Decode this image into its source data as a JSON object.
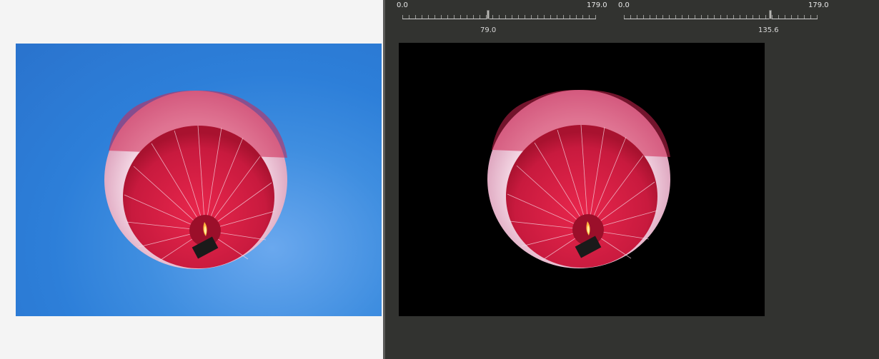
{
  "sliders": [
    {
      "min_label": "0.0",
      "max_label": "179.0",
      "min": 0,
      "max": 179,
      "value": 79.0,
      "value_label": "79.0"
    },
    {
      "min_label": "0.0",
      "max_label": "179.0",
      "min": 0,
      "max": 179,
      "value": 135.6,
      "value_label": "135.6"
    }
  ],
  "colors": {
    "left_background": "#f4f4f4",
    "right_background": "#323330",
    "sky_blue": "#2d7fd9",
    "balloon_red": "#d21f45",
    "balloon_pink": "#f2c9da",
    "mask_background": "#000000"
  },
  "images": {
    "original": "hot-air-balloon-on-blue-sky",
    "result": "hot-air-balloon-masked-on-black"
  }
}
